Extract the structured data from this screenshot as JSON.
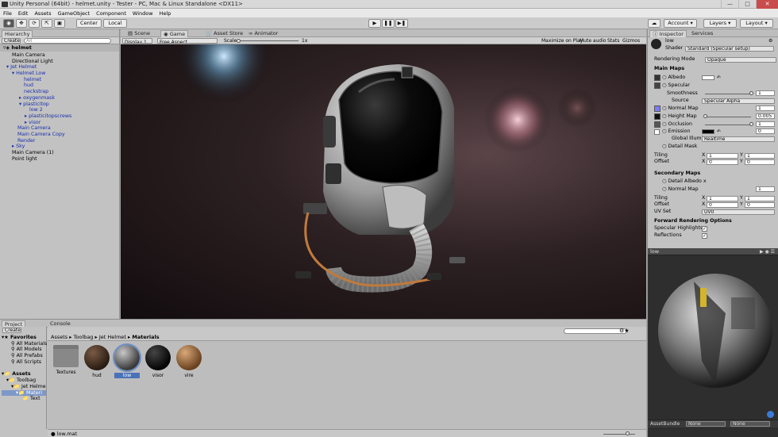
{
  "window": {
    "title": "Unity Personal (64bit) - helmet.unity - Tester - PC, Mac & Linux Standalone <DX11>",
    "min": "—",
    "max": "□",
    "close": "✕"
  },
  "menu": [
    "File",
    "Edit",
    "Assets",
    "GameObject",
    "Component",
    "Window",
    "Help"
  ],
  "toolbar": {
    "pivot": "Center",
    "space": "Local",
    "play": "▶",
    "pause": "❚❚",
    "step": "▶❚",
    "account": "Account",
    "layers": "Layers",
    "layout": "Layout"
  },
  "hierarchy": {
    "tab": "Hierarchy",
    "create": "Create",
    "search_placeholder": "All",
    "root": "helmet",
    "items": [
      {
        "label": "Main Camera",
        "style": ""
      },
      {
        "label": "Directional Light",
        "style": ""
      },
      {
        "label": "Jet Helmet",
        "style": "blue"
      },
      {
        "label": "Helmet Low",
        "style": "blue"
      },
      {
        "label": "helmet",
        "style": "blue"
      },
      {
        "label": "hud",
        "style": "blue"
      },
      {
        "label": "neckstrap",
        "style": "blue"
      },
      {
        "label": "oxygenmask",
        "style": "blue"
      },
      {
        "label": "plasticitop",
        "style": "blue"
      },
      {
        "label": "low 2",
        "style": "blue"
      },
      {
        "label": "plasticitopscrews",
        "style": "blue"
      },
      {
        "label": "visor",
        "style": "blue"
      },
      {
        "label": "Main Camera",
        "style": "blue"
      },
      {
        "label": "Main Camera Copy",
        "style": "blue"
      },
      {
        "label": "Render",
        "style": "blue"
      },
      {
        "label": "Sky",
        "style": "blue"
      },
      {
        "label": "Main Camera (1)",
        "style": ""
      },
      {
        "label": "Point light",
        "style": ""
      }
    ]
  },
  "scene_tabs": {
    "scene": "Scene",
    "game": "Game",
    "asset_store": "Asset Store",
    "animator": "Animator"
  },
  "game_bar": {
    "display": "Display 1",
    "aspect": "Free Aspect",
    "scale_label": "Scale",
    "scale_value": "1x",
    "maximize": "Maximize on Play",
    "mute": "Mute audio",
    "stats": "Stats",
    "gizmos": "Gizmos"
  },
  "inspector": {
    "tab_inspector": "Inspector",
    "tab_services": "Services",
    "material_name": "low",
    "shader_label": "Shader",
    "shader_value": "Standard (Specular setup)",
    "rendering_mode_label": "Rendering Mode",
    "rendering_mode_value": "Opaque",
    "main_maps": "Main Maps",
    "albedo": "Albedo",
    "specular": "Specular",
    "smoothness": "Smoothness",
    "smoothness_value": "1",
    "source": "Source",
    "source_value": "Specular Alpha",
    "normal_map": "Normal Map",
    "normal_value": "1",
    "height_map": "Height Map",
    "height_value": "0.005",
    "occlusion": "Occlusion",
    "occlusion_value": "1",
    "emission": "Emission",
    "emission_value": "0",
    "global_illum": "Global Illumi",
    "global_illum_value": "Realtime",
    "detail_mask": "Detail Mask",
    "tiling": "Tiling",
    "offset": "Offset",
    "x": "X",
    "y": "Y",
    "tiling_x": "1",
    "tiling_y": "1",
    "offset_x": "0",
    "offset_y": "0",
    "secondary_maps": "Secondary Maps",
    "detail_albedo": "Detail Albedo x",
    "normal_map2": "Normal Map",
    "normal_value2": "1",
    "tiling2_x": "1",
    "tiling2_y": "1",
    "offset2_x": "0",
    "offset2_y": "0",
    "uv_set": "UV Set",
    "uv_set_value": "UV0",
    "forward_options": "Forward Rendering Options",
    "specular_highlights": "Specular Highlights",
    "reflections": "Reflections",
    "colors": {
      "albedo": "#ffffff",
      "emission": "#000000",
      "normal_swatch": "#7b7bff"
    }
  },
  "preview": {
    "name": "low",
    "asset_bundle": "AssetBundle",
    "bundle_value": "None",
    "bundle_variant": "None"
  },
  "project": {
    "tab_project": "Project",
    "tab_console": "Console",
    "create": "Create",
    "favorites": "Favorites",
    "fav_items": [
      "All Materials",
      "All Models",
      "All Prefabs",
      "All Scripts"
    ],
    "assets": "Assets",
    "tree": [
      "Toolbag",
      "Jet Helme",
      "Materi",
      "Text"
    ],
    "breadcrumb": [
      "Assets",
      "Toolbag",
      "Jet Helmet",
      "Materials"
    ],
    "items": [
      {
        "name": "Textures",
        "kind": "folder"
      },
      {
        "name": "hud",
        "kind": "mat"
      },
      {
        "name": "low",
        "kind": "mat"
      },
      {
        "name": "visor",
        "kind": "mat"
      },
      {
        "name": "vire",
        "kind": "mat"
      }
    ],
    "footer_file": "low.mat"
  }
}
